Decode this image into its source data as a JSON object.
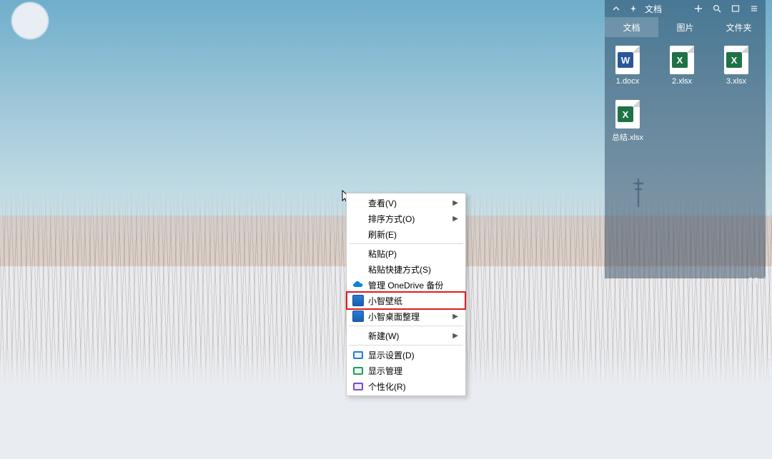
{
  "contextMenu": {
    "view": {
      "label": "查看(V)"
    },
    "sort": {
      "label": "排序方式(O)"
    },
    "refresh": {
      "label": "刷新(E)"
    },
    "paste": {
      "label": "粘贴(P)"
    },
    "paste_shortcut": {
      "label": "粘贴快捷方式(S)"
    },
    "onedrive": {
      "label": "管理 OneDrive 备份"
    },
    "wallpaper": {
      "label": "小智壁纸"
    },
    "desktop_arrange": {
      "label": "小智桌面整理"
    },
    "neww": {
      "label": "新建(W)"
    },
    "display_settings": {
      "label": "显示设置(D)"
    },
    "display_manage": {
      "label": "显示管理"
    },
    "personalize": {
      "label": "个性化(R)"
    }
  },
  "panel": {
    "title": "文档",
    "tabs": {
      "docs": "文档",
      "images": "图片",
      "folders": "文件夹"
    },
    "files": [
      {
        "name": "1.docx",
        "type": "word"
      },
      {
        "name": "2.xlsx",
        "type": "xls"
      },
      {
        "name": "3.xlsx",
        "type": "xls"
      },
      {
        "name": "总结.xlsx",
        "type": "xls"
      }
    ]
  },
  "icons": {
    "collapse": "chevron-up-icon",
    "pin": "pin-icon",
    "add": "plus-icon",
    "search": "search-icon",
    "window": "window-icon",
    "menu": "menu-icon",
    "submenu": "▶"
  },
  "edge_hint": "▮▮ ☰"
}
